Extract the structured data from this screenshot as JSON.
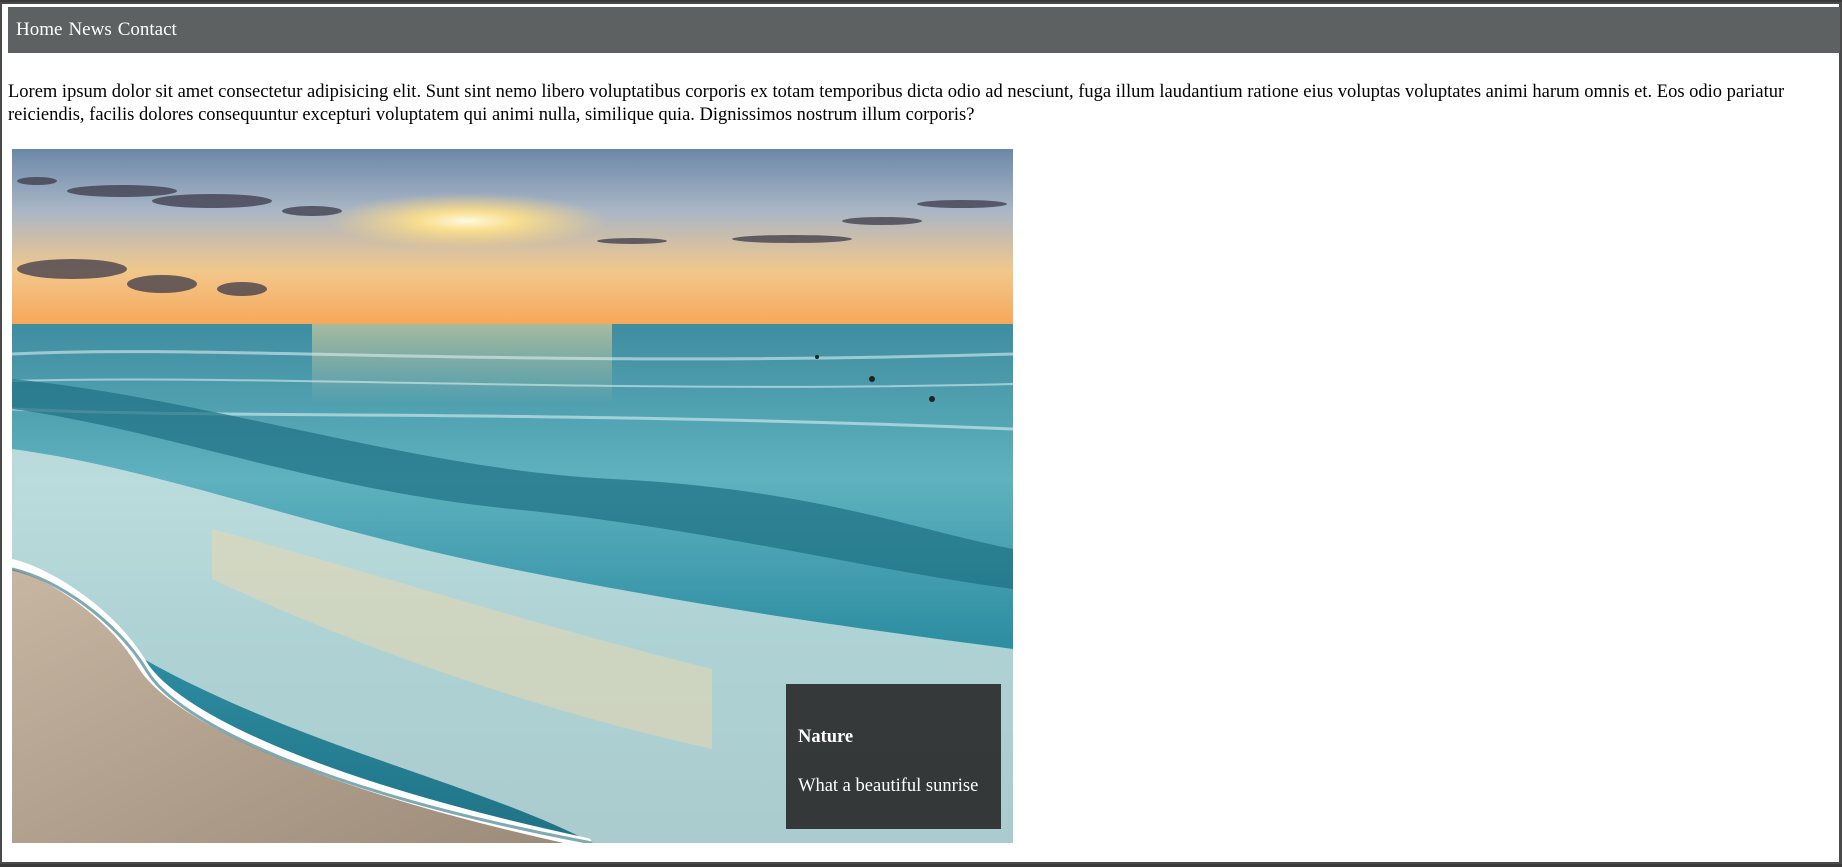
{
  "nav": {
    "items": [
      {
        "label": "Home"
      },
      {
        "label": "News"
      },
      {
        "label": "Contact"
      }
    ]
  },
  "intro_text": "Lorem ipsum dolor sit amet consectetur adipisicing elit. Sunt sint nemo libero voluptatibus corporis ex totam temporibus dicta odio ad nesciunt, fuga illum laudantium ratione eius voluptas voluptates animi harum omnis et. Eos odio pariatur reiciendis, facilis dolores consequuntur excepturi voluptatem qui animi nulla, similique quia. Dignissimos nostrum illum corporis?",
  "figure": {
    "caption_title": "Nature",
    "caption_text": "What a beautiful sunrise"
  },
  "colors": {
    "navbar": "#5e6161",
    "page_bg": "#ffffff",
    "caption_bg": "#282828"
  }
}
